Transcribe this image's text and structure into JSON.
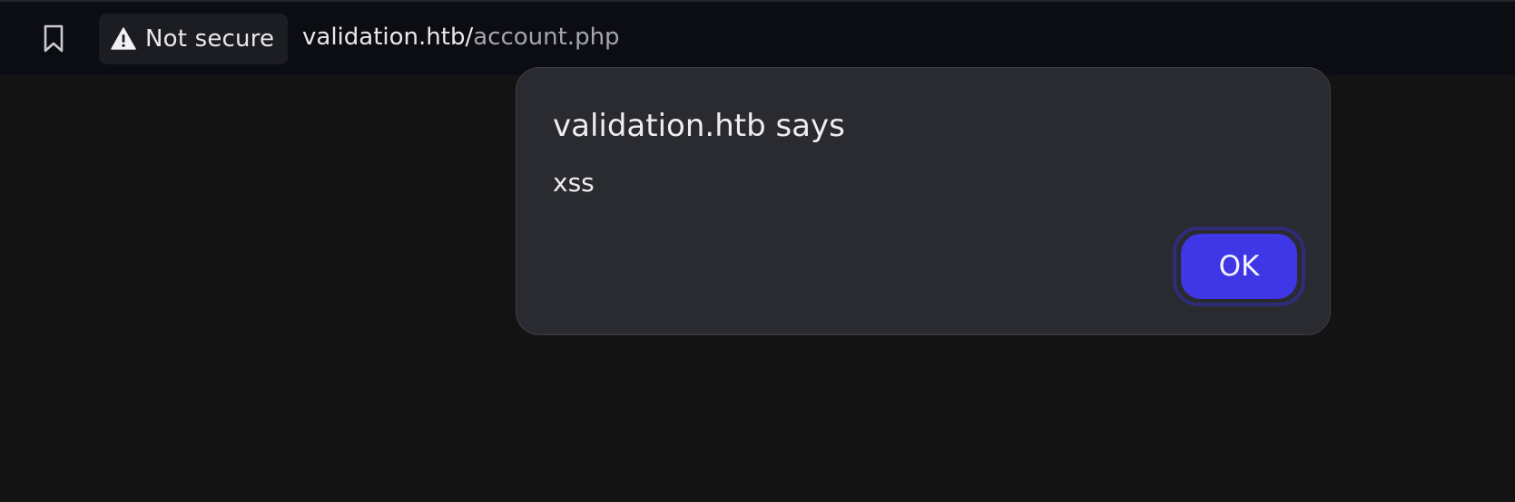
{
  "browser": {
    "security_label": "Not secure",
    "url_host": "validation.htb/",
    "url_path": "account.php",
    "icons": {
      "bookmark": "bookmark-icon",
      "warning": "warning-triangle-icon"
    }
  },
  "dialog": {
    "title": "validation.htb says",
    "message": "xss",
    "ok_label": "OK"
  },
  "colors": {
    "page_background": "#131313",
    "toolbar_background": "#0c0d12",
    "dialog_background": "#2a2b30",
    "ok_button": "#3f37e6"
  }
}
